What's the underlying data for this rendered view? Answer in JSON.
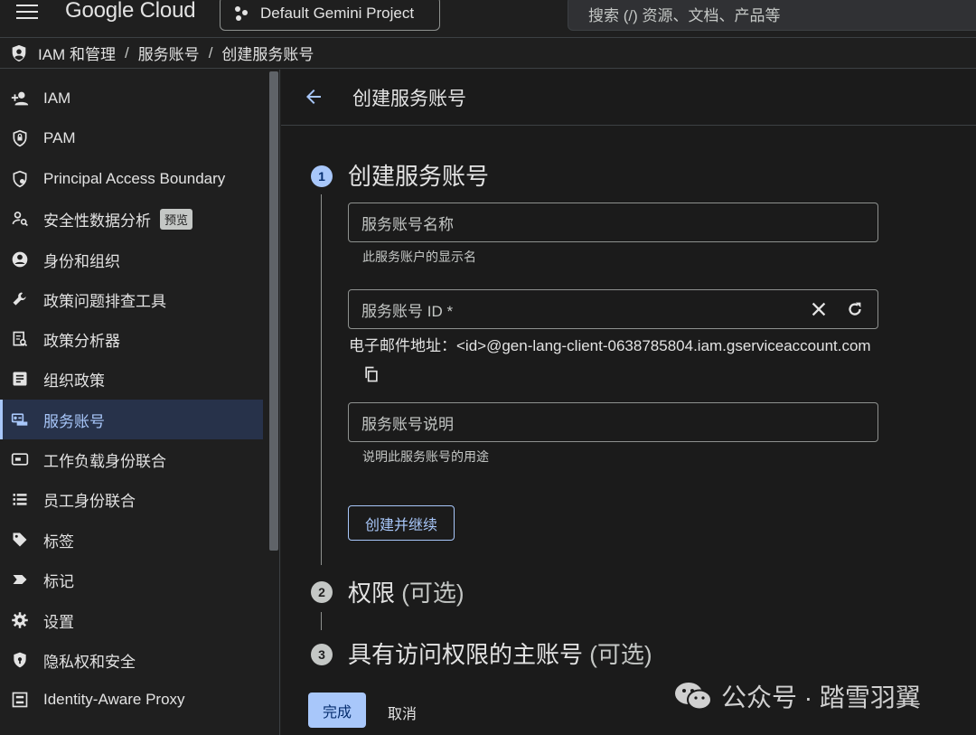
{
  "topbar": {
    "logo": "Google Cloud",
    "project": "Default Gemini Project",
    "search_placeholder": "搜索 (/) 资源、文档、产品等"
  },
  "breadcrumb": [
    "IAM 和管理",
    "服务账号",
    "创建服务账号"
  ],
  "sidebar": {
    "items": [
      {
        "label": "IAM",
        "icon": "person-add-icon"
      },
      {
        "label": "PAM",
        "icon": "shield-lock-icon"
      },
      {
        "label": "Principal Access Boundary",
        "icon": "boundary-shield-icon"
      },
      {
        "label": "安全性数据分析",
        "icon": "person-search-icon",
        "badge": "预览"
      },
      {
        "label": "身份和组织",
        "icon": "account-circle-icon"
      },
      {
        "label": "政策问题排查工具",
        "icon": "wrench-icon"
      },
      {
        "label": "政策分析器",
        "icon": "policy-analyzer-icon"
      },
      {
        "label": "组织政策",
        "icon": "document-icon"
      },
      {
        "label": "服务账号",
        "icon": "service-account-icon",
        "active": true
      },
      {
        "label": "工作负载身份联合",
        "icon": "id-card-icon"
      },
      {
        "label": "员工身份联合",
        "icon": "list-icon"
      },
      {
        "label": "标签",
        "icon": "tag-icon"
      },
      {
        "label": "标记",
        "icon": "label-icon"
      },
      {
        "label": "设置",
        "icon": "gear-icon"
      },
      {
        "label": "隐私权和安全",
        "icon": "privacy-shield-icon"
      },
      {
        "label": "Identity-Aware Proxy",
        "icon": "proxy-icon"
      }
    ]
  },
  "main": {
    "title": "创建服务账号",
    "steps": [
      {
        "number": "1",
        "title": "创建服务账号",
        "optional": ""
      },
      {
        "number": "2",
        "title": "权限",
        "optional": "(可选)"
      },
      {
        "number": "3",
        "title": "具有访问权限的主账号",
        "optional": "(可选)"
      }
    ],
    "fields": {
      "name_placeholder": "服务账号名称",
      "name_help": "此服务账户的显示名",
      "id_placeholder": "服务账号 ID *",
      "email": "电子邮件地址：<id>@gen-lang-client-0638785804.iam.gserviceaccount.com",
      "desc_placeholder": "服务账号说明",
      "desc_help": "说明此服务账号的用途"
    },
    "buttons": {
      "create_continue": "创建并继续",
      "done": "完成",
      "cancel": "取消"
    }
  },
  "watermark": "公众号 · 踏雪羽翼",
  "colors": {
    "accent": "#a8c7fa",
    "background": "#1f1f1f",
    "active_nav": "#27324a"
  }
}
